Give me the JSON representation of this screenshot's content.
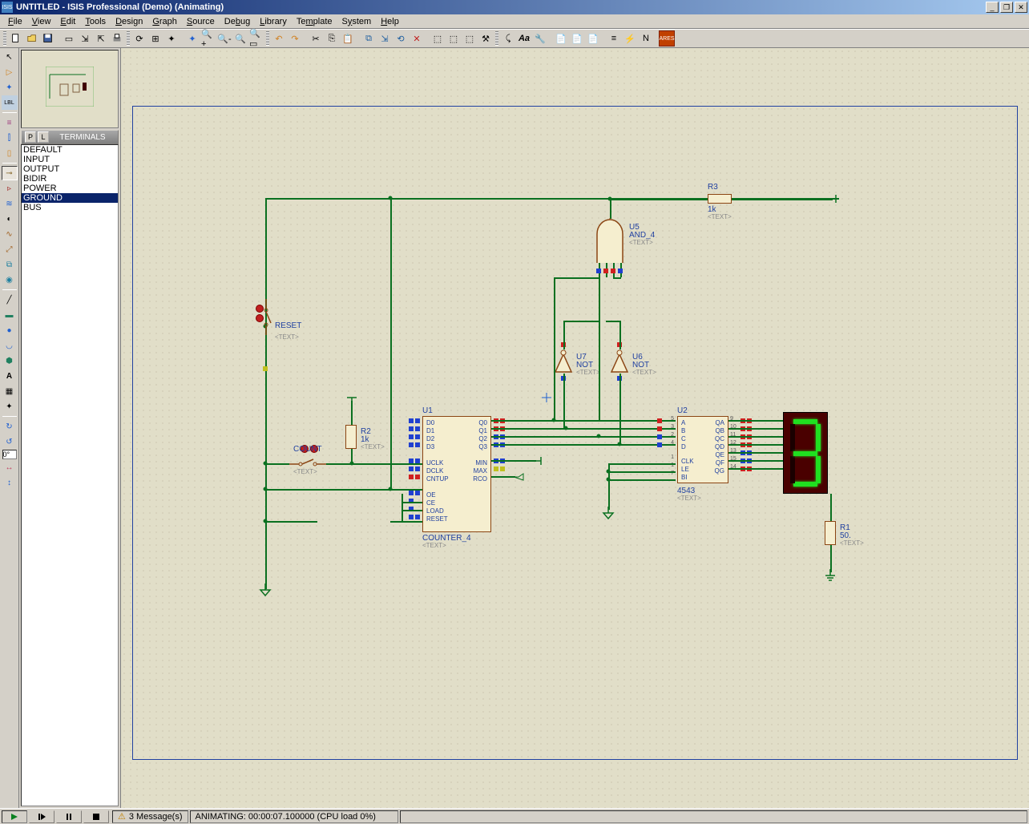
{
  "title": "UNTITLED - ISIS Professional (Demo) (Animating)",
  "menu": [
    "File",
    "View",
    "Edit",
    "Tools",
    "Design",
    "Graph",
    "Source",
    "Debug",
    "Library",
    "Template",
    "System",
    "Help"
  ],
  "terminals_header": "TERMINALS",
  "terminals": [
    "DEFAULT",
    "INPUT",
    "OUTPUT",
    "BIDIR",
    "POWER",
    "GROUND",
    "BUS"
  ],
  "selected_terminal": "GROUND",
  "rotation_value": "0°",
  "status": {
    "messages": "3 Message(s)",
    "sim": "ANIMATING: 00:00:07.100000 (CPU load 0%)"
  },
  "components": {
    "u1": {
      "ref": "U1",
      "type": "COUNTER_4",
      "text": "<TEXT>",
      "left_pins": [
        "D0",
        "D1",
        "D2",
        "D3",
        "",
        "UCLK",
        "DCLK",
        "CNTUP",
        "",
        "OE",
        "CE",
        "LOAD",
        "RESET"
      ],
      "right_pins": [
        "Q0",
        "Q1",
        "Q2",
        "Q3",
        "",
        "MIN",
        "MAX",
        "RCO"
      ]
    },
    "u2": {
      "ref": "U2",
      "type": "4543",
      "text": "<TEXT>",
      "left_pins": [
        [
          "5",
          "A"
        ],
        [
          "3",
          "B"
        ],
        [
          "2",
          "C"
        ],
        [
          "4",
          "D"
        ],
        [
          "",
          ""
        ],
        [
          "1",
          "CLK"
        ],
        [
          "1",
          "LE"
        ],
        [
          "7",
          "BI"
        ]
      ],
      "right_pins": [
        [
          "QA",
          "9"
        ],
        [
          "QB",
          "10"
        ],
        [
          "QC",
          "11"
        ],
        [
          "QD",
          "12"
        ],
        [
          "QE",
          "13"
        ],
        [
          "QF",
          "15"
        ],
        [
          "QG",
          "14"
        ]
      ]
    },
    "u5": {
      "ref": "U5",
      "type": "AND_4",
      "text": "<TEXT>"
    },
    "u6": {
      "ref": "U6",
      "type": "NOT",
      "text": "<TEXT>"
    },
    "u7": {
      "ref": "U7",
      "type": "NOT",
      "text": "<TEXT>"
    },
    "r1": {
      "ref": "R1",
      "value": "50.",
      "text": "<TEXT>"
    },
    "r2": {
      "ref": "R2",
      "value": "1k",
      "text": "<TEXT>"
    },
    "r3": {
      "ref": "R3",
      "value": "1k",
      "text": "<TEXT>"
    },
    "reset": {
      "label": "RESET",
      "text": "<TEXT>"
    },
    "count": {
      "label": "COUNT",
      "text": "<TEXT>"
    }
  }
}
